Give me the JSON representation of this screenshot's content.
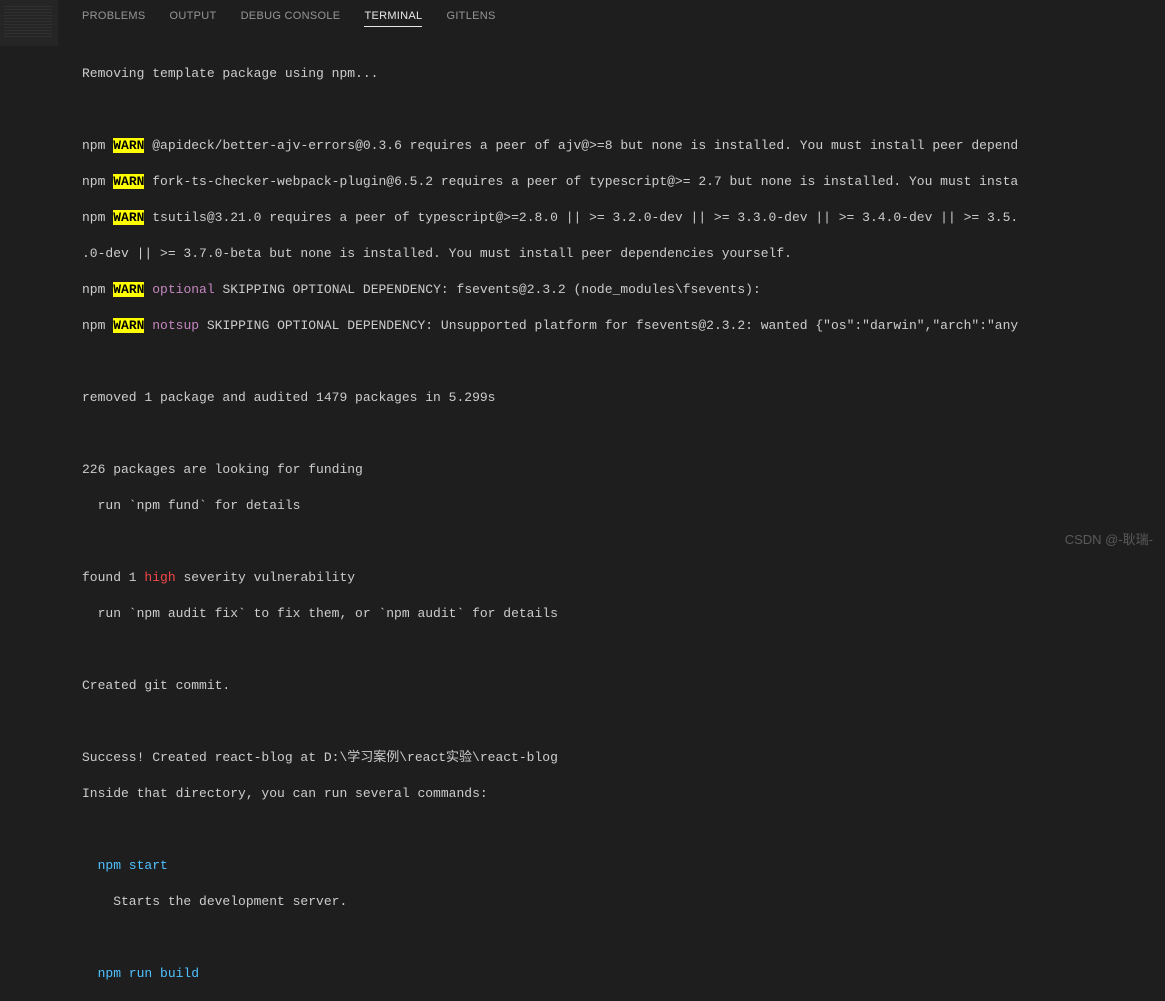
{
  "tabs": {
    "problems": "PROBLEMS",
    "output": "OUTPUT",
    "debug": "DEBUG CONSOLE",
    "terminal": "TERMINAL",
    "gitlens": "GITLENS"
  },
  "term": {
    "removing": "Removing template package using npm...",
    "npm": "npm",
    "warn": "WARN",
    "w1": " @apideck/better-ajv-errors@0.3.6 requires a peer of ajv@>=8 but none is installed. You must install peer depend",
    "w2": " fork-ts-checker-webpack-plugin@6.5.2 requires a peer of typescript@>= 2.7 but none is installed. You must insta",
    "w3": " tsutils@3.21.0 requires a peer of typescript@>=2.8.0 || >= 3.2.0-dev || >= 3.3.0-dev || >= 3.4.0-dev || >= 3.5.",
    "w3b": ".0-dev || >= 3.7.0-beta but none is installed. You must install peer dependencies yourself.",
    "optional": "optional",
    "w4": " SKIPPING OPTIONAL DEPENDENCY: fsevents@2.3.2 (node_modules\\fsevents):",
    "notsup": "notsup",
    "w5": " SKIPPING OPTIONAL DEPENDENCY: Unsupported platform for fsevents@2.3.2: wanted {\"os\":\"darwin\",\"arch\":\"any",
    "removed": "removed 1 package and audited 1479 packages in 5.299s",
    "funding1": "226 packages are looking for funding",
    "funding2": "  run `npm fund` for details",
    "found_a": "found 1 ",
    "high": "high",
    "found_b": " severity vulnerability",
    "audit": "  run `npm audit fix` to fix them, or `npm audit` for details",
    "commit": "Created git commit.",
    "success": "Success! Created react-blog at D:\\学习案例\\react实验\\react-blog",
    "inside": "Inside that directory, you can run several commands:",
    "npm_start": "  npm start",
    "start_desc": "    Starts the development server.",
    "npm_build": "  npm run build"
  },
  "watermark": "CSDN @-耿瑞-"
}
